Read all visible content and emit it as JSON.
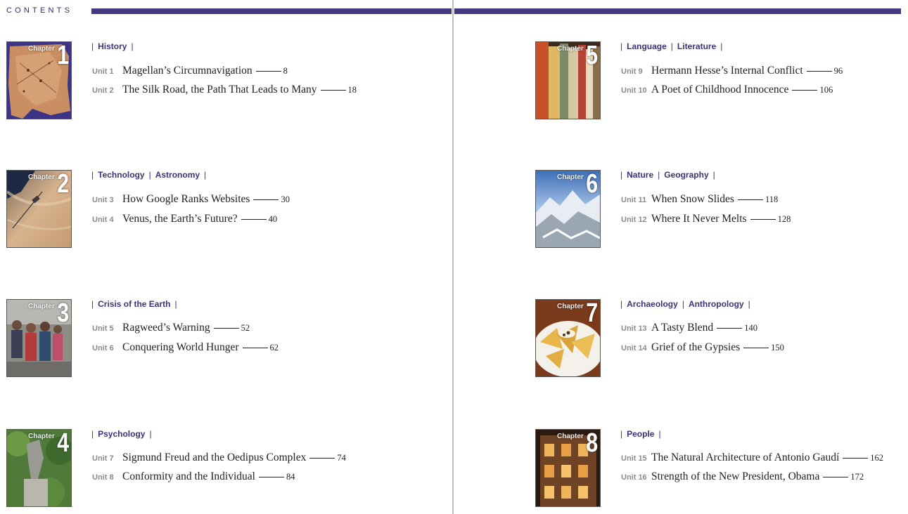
{
  "header": {
    "contents_label": "CONTENTS"
  },
  "chapters": [
    {
      "chapter_word": "Chapter",
      "number": "1",
      "categories": [
        "History"
      ],
      "units": [
        {
          "label": "Unit 1",
          "title": "Magellan’s Circumnavigation",
          "page": "8"
        },
        {
          "label": "Unit 2",
          "title": "The Silk Road, the Path That Leads to Many",
          "page": "18"
        }
      ]
    },
    {
      "chapter_word": "Chapter",
      "number": "2",
      "categories": [
        "Technology",
        "Astronomy"
      ],
      "units": [
        {
          "label": "Unit 3",
          "title": "How Google Ranks Websites",
          "page": "30"
        },
        {
          "label": "Unit 4",
          "title": "Venus, the Earth’s Future?",
          "page": "40"
        }
      ]
    },
    {
      "chapter_word": "Chapter",
      "number": "3",
      "categories": [
        "Crisis of the Earth"
      ],
      "units": [
        {
          "label": "Unit 5",
          "title": "Ragweed’s Warning",
          "page": "52"
        },
        {
          "label": "Unit 6",
          "title": "Conquering World Hunger",
          "page": "62"
        }
      ]
    },
    {
      "chapter_word": "Chapter",
      "number": "4",
      "categories": [
        "Psychology"
      ],
      "units": [
        {
          "label": "Unit 7",
          "title": "Sigmund Freud and the Oedipus Complex",
          "page": "74"
        },
        {
          "label": "Unit 8",
          "title": "Conformity and the Individual",
          "page": "84"
        }
      ]
    },
    {
      "chapter_word": "Chapter",
      "number": "5",
      "categories": [
        "Language",
        "Literature"
      ],
      "units": [
        {
          "label": "Unit 9",
          "title": "Hermann Hesse’s Internal Conflict",
          "page": "96"
        },
        {
          "label": "Unit 10",
          "title": "A Poet of Childhood Innocence",
          "page": "106"
        }
      ]
    },
    {
      "chapter_word": "Chapter",
      "number": "6",
      "categories": [
        "Nature",
        "Geography"
      ],
      "units": [
        {
          "label": "Unit 11",
          "title": "When Snow Slides",
          "page": "118"
        },
        {
          "label": "Unit 12",
          "title": "Where It Never Melts",
          "page": "128"
        }
      ]
    },
    {
      "chapter_word": "Chapter",
      "number": "7",
      "categories": [
        "Archaeology",
        "Anthropology"
      ],
      "units": [
        {
          "label": "Unit 13",
          "title": "A Tasty Blend",
          "page": "140"
        },
        {
          "label": "Unit 14",
          "title": "Grief of the Gypsies",
          "page": "150"
        }
      ]
    },
    {
      "chapter_word": "Chapter",
      "number": "8",
      "categories": [
        "People"
      ],
      "units": [
        {
          "label": "Unit 15",
          "title": "The Natural Architecture of Antonio Gaudí",
          "page": "162"
        },
        {
          "label": "Unit 16",
          "title": "Strength of the New President, Obama",
          "page": "172"
        }
      ]
    }
  ],
  "colors": {
    "accent_bar": "#3f3780",
    "category_text": "#3a3378",
    "unit_label": "#8b8b8b"
  },
  "thumbnail_icons": [
    "old-map-photo",
    "satellite-planet-photo",
    "crowd-photo",
    "statue-photo",
    "books-photo",
    "snowy-mountains-photo",
    "nachos-photo",
    "lit-building-photo"
  ]
}
